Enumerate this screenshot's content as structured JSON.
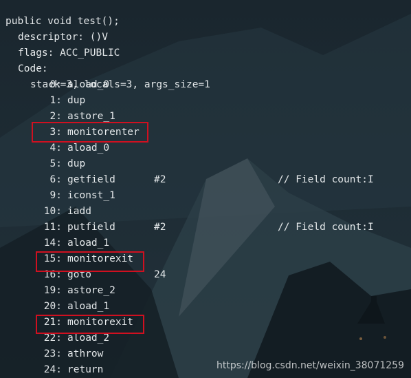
{
  "method_header": {
    "signature": "public void test();",
    "descriptor": "descriptor: ()V",
    "flags": "flags: ACC_PUBLIC",
    "code_label": "Code:",
    "stack_info": "stack=3, locals=3, args_size=1"
  },
  "instructions": [
    {
      "index": "0:",
      "op": "aload_0",
      "arg": "",
      "comment": ""
    },
    {
      "index": "1:",
      "op": "dup",
      "arg": "",
      "comment": ""
    },
    {
      "index": "2:",
      "op": "astore_1",
      "arg": "",
      "comment": ""
    },
    {
      "index": "3:",
      "op": "monitorenter",
      "arg": "",
      "comment": ""
    },
    {
      "index": "4:",
      "op": "aload_0",
      "arg": "",
      "comment": ""
    },
    {
      "index": "5:",
      "op": "dup",
      "arg": "",
      "comment": ""
    },
    {
      "index": "6:",
      "op": "getfield",
      "arg": "#2",
      "comment": "// Field count:I"
    },
    {
      "index": "9:",
      "op": "iconst_1",
      "arg": "",
      "comment": ""
    },
    {
      "index": "10:",
      "op": "iadd",
      "arg": "",
      "comment": ""
    },
    {
      "index": "11:",
      "op": "putfield",
      "arg": "#2",
      "comment": "// Field count:I"
    },
    {
      "index": "14:",
      "op": "aload_1",
      "arg": "",
      "comment": ""
    },
    {
      "index": "15:",
      "op": "monitorexit",
      "arg": "",
      "comment": ""
    },
    {
      "index": "16:",
      "op": "goto",
      "arg": "24",
      "comment": ""
    },
    {
      "index": "19:",
      "op": "astore_2",
      "arg": "",
      "comment": ""
    },
    {
      "index": "20:",
      "op": "aload_1",
      "arg": "",
      "comment": ""
    },
    {
      "index": "21:",
      "op": "monitorexit",
      "arg": "",
      "comment": ""
    },
    {
      "index": "22:",
      "op": "aload_2",
      "arg": "",
      "comment": ""
    },
    {
      "index": "23:",
      "op": "athrow",
      "arg": "",
      "comment": ""
    },
    {
      "index": "24:",
      "op": "return",
      "arg": "",
      "comment": ""
    }
  ],
  "highlight_color": "#d01020",
  "watermark": "https://blog.csdn.net/weixin_38071259"
}
